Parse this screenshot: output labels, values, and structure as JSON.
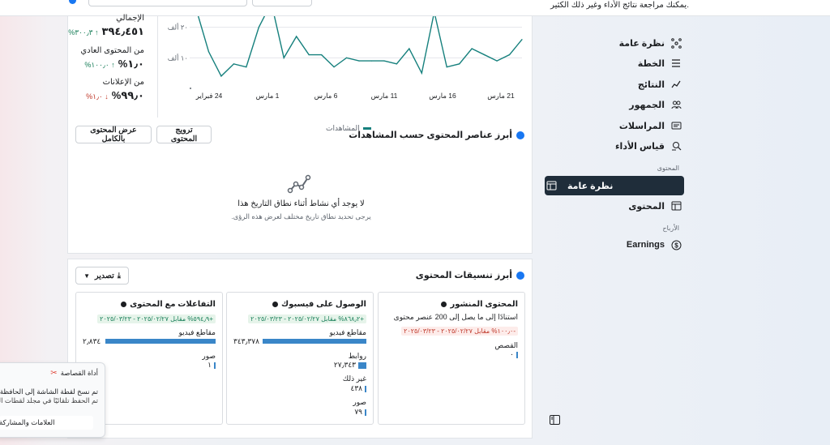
{
  "header": {
    "description": "يمكنك مراجعة نتائج الأداء وغير ذلك الكثير."
  },
  "sidebar": {
    "items": [
      {
        "label": "نظرة عامة",
        "icon": "overview-icon"
      },
      {
        "label": "الخطة",
        "icon": "plan-icon"
      },
      {
        "label": "النتائج",
        "icon": "results-icon"
      },
      {
        "label": "الجمهور",
        "icon": "audience-icon"
      },
      {
        "label": "المراسلات",
        "icon": "messages-icon"
      },
      {
        "label": "قياس الأداء",
        "icon": "benchmark-icon"
      }
    ],
    "content_section": "المحتوى",
    "content_items": [
      {
        "label": "نظرة عامة",
        "icon": "content-overview-icon",
        "active": true
      },
      {
        "label": "المحتوى",
        "icon": "content-icon"
      }
    ],
    "monetization_section": "الأرباح",
    "monetization_items": [
      {
        "label": "Earnings",
        "icon": "dollar-icon"
      }
    ]
  },
  "kpis": [
    {
      "title": "الإجمالي",
      "value": "٣٩٤٫٤٥١",
      "change": "٣٠٠٫٣%",
      "direction": "up"
    },
    {
      "title": "من المحتوى العادي",
      "value": "١٫٠%",
      "change": "١٠٠٫٠%",
      "direction": "up"
    },
    {
      "title": "من الإعلانات",
      "value": "٩٩٫٠%",
      "change": "١٫٠%",
      "direction": "down"
    }
  ],
  "chart_data": {
    "type": "line",
    "series": [
      {
        "name": "المشاهدات",
        "color": "#16807d",
        "values": [
          26,
          12,
          4,
          8,
          7,
          20,
          28,
          10,
          17,
          11,
          11,
          7,
          10,
          9,
          9,
          9,
          8,
          13,
          5,
          25,
          7,
          8,
          13,
          11,
          9,
          11,
          16
        ]
      }
    ],
    "ytick_labels": [
      "١٠ ألف",
      "٢٠ ألف"
    ],
    "yticks": [
      10,
      20
    ],
    "ylim": [
      0,
      30
    ],
    "xtick_labels": [
      "24 فبراير",
      "1 مارس",
      "6 مارس",
      "11 مارس",
      "16 مارس",
      "21 مارس"
    ]
  },
  "top_content": {
    "title": "أبرز عناصر المحتوى حسب المشاهدات",
    "promote_label": "ترويج المحتوى",
    "view_all_label": "عرض المحتوى بالكامل",
    "empty_title": "لا يوجد أي نشاط أثناء نطاق التاريخ هذا",
    "empty_sub": "يرجى تحديد نطاق تاريخ مختلف لعرض هذه الرؤى."
  },
  "formats": {
    "title": "أبرز تنسيقات المحتوى",
    "export_label": "تصدير",
    "cards": [
      {
        "title": "المحتوى المنشور",
        "note": "استنادًا إلى ما يصل إلى 200 عنصر محتوى",
        "badge": "-١٠٠٫٠% مقابل ٢٠٢٥/٠٢/٢٧ - ٢٠٢٥/٠٣/٢٣",
        "badge_type": "red",
        "rows": [
          {
            "label": "القصص",
            "value": "٠"
          }
        ]
      },
      {
        "title": "الوصول على فيسبوك",
        "badge": "+٨٦٨٫٢% مقابل ٢٠٢٥/٠٢/٢٧ - ٢٠٢٥/٠٣/٢٣",
        "badge_type": "green",
        "bar": {
          "label": "مقاطع فيديو",
          "value": "٣٤٣٫٣٧٨",
          "fraction": 1.0
        },
        "rows": [
          {
            "label": "روابط",
            "value": "٢٧٫٣٤٣",
            "fraction": 0.08
          },
          {
            "label": "غير ذلك",
            "value": "٤٣٨",
            "fraction": 0.01
          },
          {
            "label": "صور",
            "value": "٧٩",
            "fraction": 0.005
          }
        ]
      },
      {
        "title": "التفاعلات مع المحتوى",
        "badge": "+٥٩٤٫٩% مقابل ٢٠٢٥/٠٢/٢٧ - ٢٠٢٥/٠٣/٢٣",
        "badge_type": "green",
        "bar": {
          "label": "مقاطع فيديو",
          "value": "٢٫٨٣٤",
          "fraction": 1.0
        },
        "rows": [
          {
            "label": "صور",
            "value": "١",
            "fraction": 0.005
          }
        ]
      }
    ]
  },
  "snipping": {
    "title": "أداة القصاصة",
    "text1": "تم نسخ لقطة الشاشة إلى الحافظة.",
    "text2": "تم الحفظ تلقائيًا في مجلد لقطات الشاشة",
    "button": "العلامات والمشاركة"
  }
}
